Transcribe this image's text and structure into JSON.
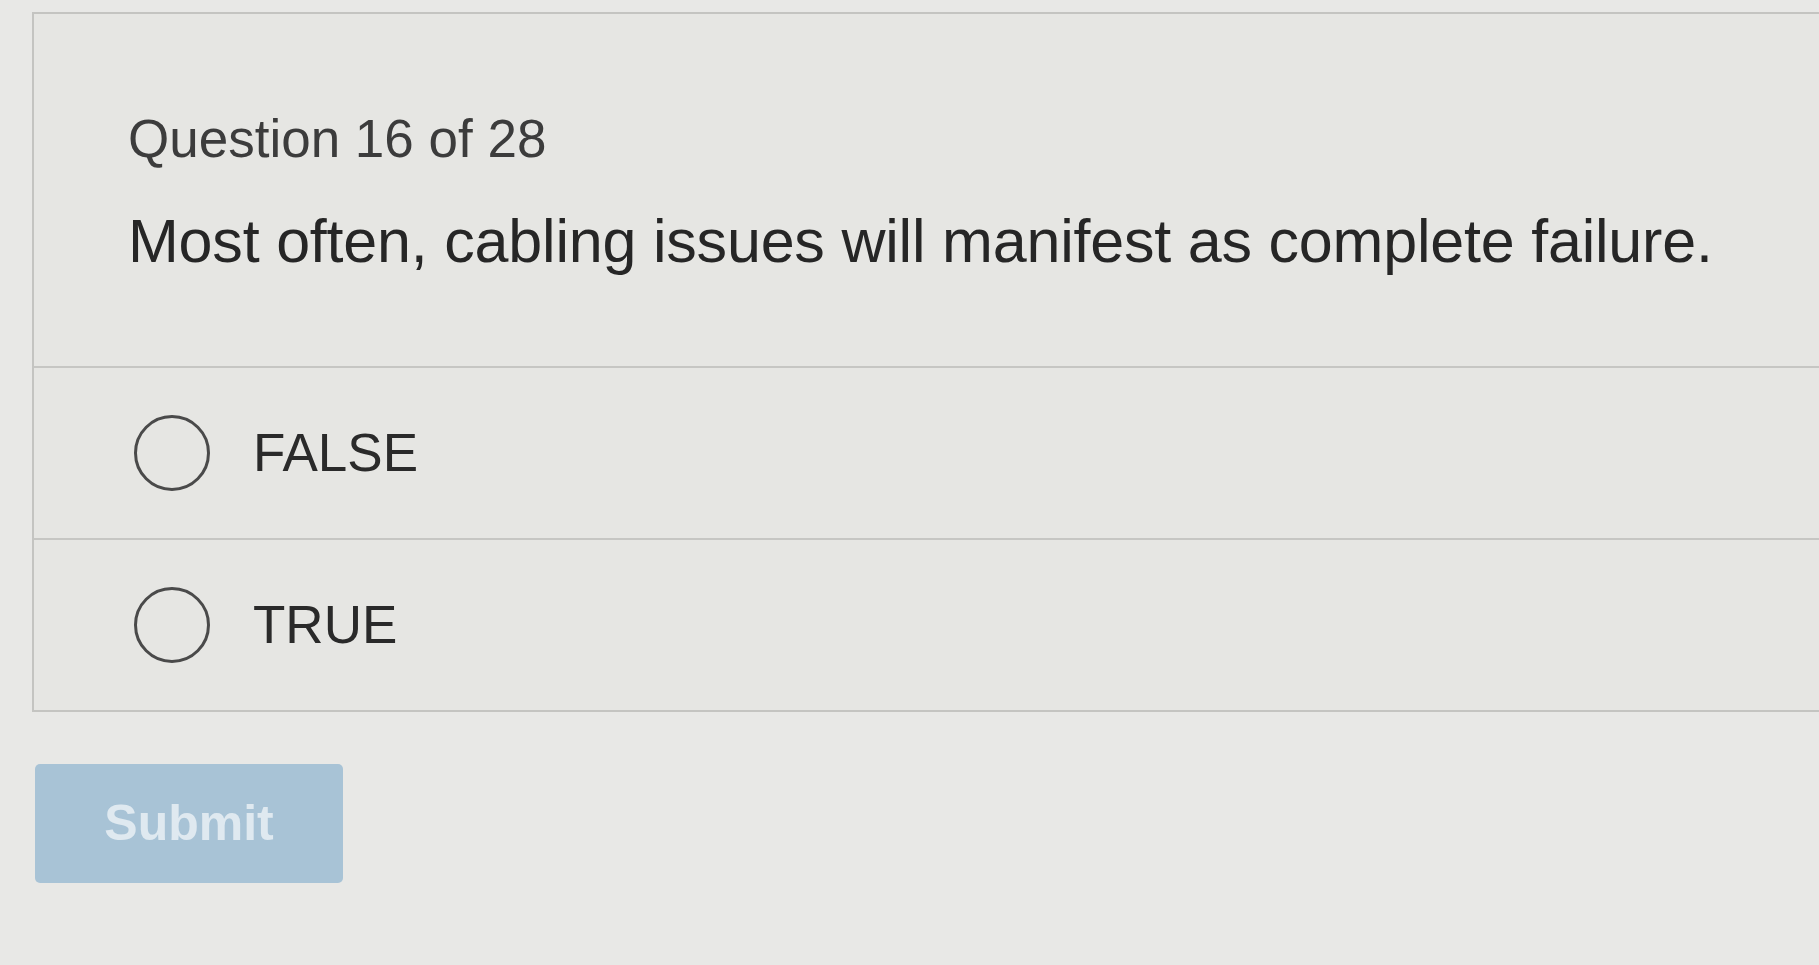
{
  "quiz": {
    "progress": "Question 16 of 28",
    "question": "Most often, cabling issues will manifest as complete failure.",
    "options": [
      {
        "label": "FALSE",
        "selected": false
      },
      {
        "label": "TRUE",
        "selected": false
      }
    ],
    "submit": {
      "label": "Submit",
      "disabled": true
    }
  }
}
